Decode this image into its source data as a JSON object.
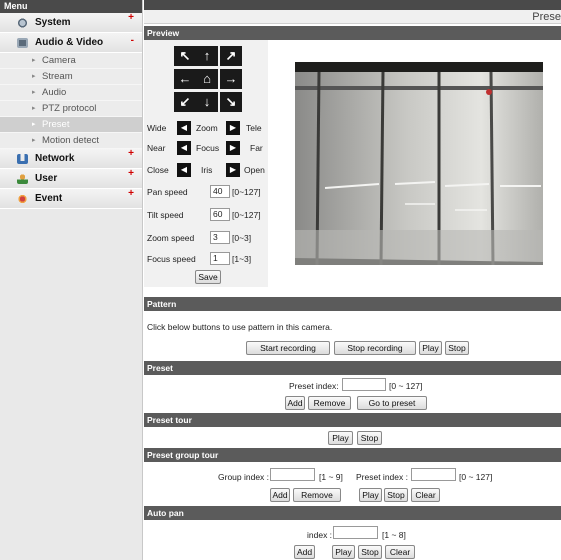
{
  "sidebar": {
    "title": "Menu",
    "groups": {
      "system": {
        "label": "System",
        "sign": "+"
      },
      "audio_video": {
        "label": "Audio & Video",
        "sign": "-"
      },
      "network": {
        "label": "Network",
        "sign": "+"
      },
      "user": {
        "label": "User",
        "sign": "+"
      },
      "event": {
        "label": "Event",
        "sign": "+"
      }
    },
    "subitems": [
      "Camera",
      "Stream",
      "Audio",
      "PTZ protocol",
      "Preset",
      "Motion detect"
    ],
    "arrow": "▸",
    "active_item": "Preset"
  },
  "page": {
    "title": "Prese"
  },
  "preview": {
    "heading": "Preview",
    "zoom": {
      "left": "Wide",
      "mid": "Zoom",
      "right": "Tele"
    },
    "focus": {
      "left": "Near",
      "mid": "Focus",
      "right": "Far"
    },
    "iris": {
      "left": "Close",
      "mid": "Iris",
      "right": "Open"
    },
    "pan_speed": {
      "label": "Pan speed",
      "value": "40",
      "range": "[0~127]"
    },
    "tilt_speed": {
      "label": "Tilt speed",
      "value": "60",
      "range": "[0~127]"
    },
    "zoom_speed": {
      "label": "Zoom speed",
      "value": "3",
      "range": "[0~3]"
    },
    "focus_speed": {
      "label": "Focus speed",
      "value": "1",
      "range": "[1~3]"
    },
    "save": "Save",
    "arrows": {
      "ul": "↖",
      "up": "↑",
      "ur": "↗",
      "left": "←",
      "home": "⌂",
      "right": "→",
      "dl": "↙",
      "down": "↓",
      "dr": "↘",
      "tri_left": "◀",
      "tri_right": "▶"
    }
  },
  "pattern": {
    "heading": "Pattern",
    "description": "Click below buttons to use pattern in this camera.",
    "start": "Start recording",
    "stop_rec": "Stop recording",
    "play": "Play",
    "stop": "Stop"
  },
  "preset": {
    "heading": "Preset",
    "index_label": "Preset index:",
    "index_value": "",
    "range": "[0 ~ 127]",
    "add": "Add",
    "remove": "Remove",
    "goto": "Go to preset"
  },
  "preset_tour": {
    "heading": "Preset tour",
    "play": "Play",
    "stop": "Stop"
  },
  "preset_group_tour": {
    "heading": "Preset group tour",
    "group_label": "Group index :",
    "group_value": "",
    "group_range": "[1 ~ 9]",
    "preset_label": "Preset index :",
    "preset_value": "",
    "preset_range": "[0 ~ 127]",
    "add": "Add",
    "remove": "Remove",
    "play": "Play",
    "stop": "Stop",
    "clear": "Clear"
  },
  "auto_pan": {
    "heading": "Auto pan",
    "index_label": "index :",
    "index_value": "",
    "range": "[1 ~ 8]",
    "add": "Add",
    "play": "Play",
    "stop": "Stop",
    "clear": "Clear"
  }
}
